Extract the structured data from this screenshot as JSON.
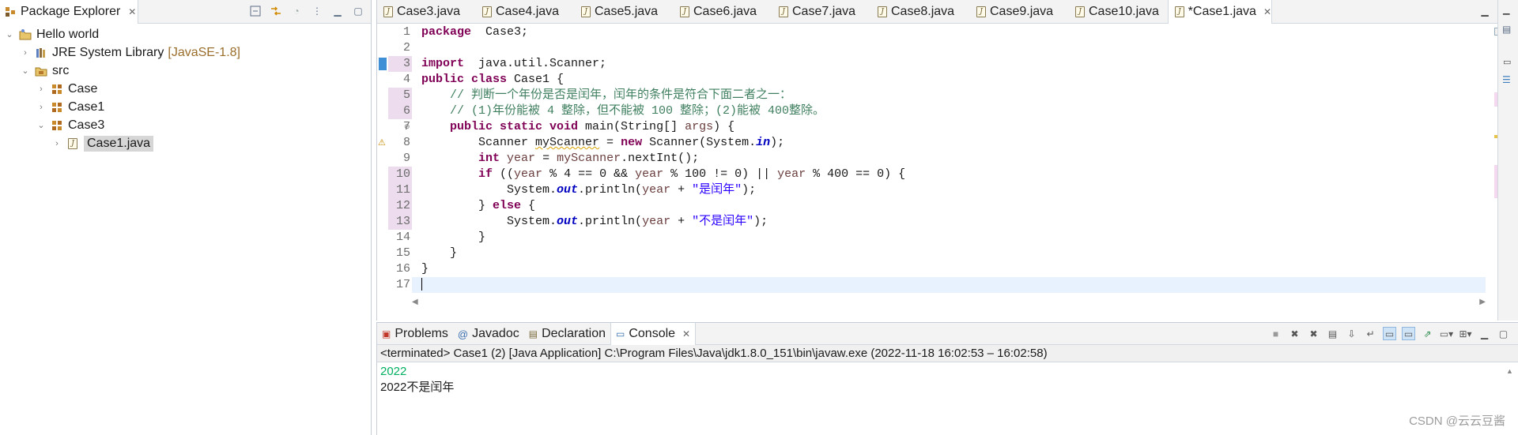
{
  "package_explorer": {
    "title": "Package Explorer",
    "tree": [
      {
        "label": "Hello world",
        "decorator": "",
        "depth": 0,
        "state": "expanded",
        "icon": "project-icon"
      },
      {
        "label": "JRE System Library",
        "decorator": "[JavaSE-1.8]",
        "depth": 1,
        "state": "collapsed",
        "icon": "library-icon"
      },
      {
        "label": "src",
        "decorator": "",
        "depth": 1,
        "state": "expanded",
        "icon": "source-folder-icon"
      },
      {
        "label": "Case",
        "decorator": "",
        "depth": 2,
        "state": "collapsed",
        "icon": "package-icon"
      },
      {
        "label": "Case1",
        "decorator": "",
        "depth": 2,
        "state": "collapsed",
        "icon": "package-icon"
      },
      {
        "label": "Case3",
        "decorator": "",
        "depth": 2,
        "state": "expanded",
        "icon": "package-icon"
      },
      {
        "label": "Case1.java",
        "decorator": "",
        "depth": 3,
        "state": "collapsed",
        "icon": "java-file-icon",
        "selected": true
      }
    ]
  },
  "editor": {
    "tabs": [
      "Case3.java",
      "Case4.java",
      "Case5.java",
      "Case6.java",
      "Case7.java",
      "Case8.java",
      "Case9.java",
      "Case10.java",
      "*Case1.java"
    ],
    "active_tab": 8,
    "line_numbers": [
      "1",
      "2",
      "3",
      "4",
      "5",
      "6",
      "7",
      "8",
      "9",
      "10",
      "11",
      "12",
      "13",
      "14",
      "15",
      "16",
      "17"
    ],
    "code": [
      [
        [
          "kw",
          "package"
        ],
        [
          "",
          "  Case3;"
        ]
      ],
      [],
      [
        [
          "kw",
          "import"
        ],
        [
          "",
          "  java.util.Scanner;"
        ]
      ],
      [
        [
          "kw",
          "public class"
        ],
        [
          "",
          " Case1 {"
        ]
      ],
      [
        [
          "",
          "    "
        ],
        [
          "cm",
          "// 判断一个年份是否是闰年，闰年的条件是符合下面二者之一："
        ]
      ],
      [
        [
          "",
          "    "
        ],
        [
          "cm",
          "// (1)年份能被 4 整除，但不能被 100 整除；(2)能被 400整除。"
        ]
      ],
      [
        [
          "",
          "    "
        ],
        [
          "kw",
          "public static void"
        ],
        [
          "",
          " main(String[] "
        ],
        [
          "vr",
          "args"
        ],
        [
          "",
          ") {"
        ]
      ],
      [
        [
          "",
          "        Scanner "
        ],
        [
          "wrn",
          "myScanner"
        ],
        [
          "",
          " = "
        ],
        [
          "kw",
          "new"
        ],
        [
          "",
          " Scanner(System."
        ],
        [
          "fi",
          "in"
        ],
        [
          "",
          ");"
        ]
      ],
      [
        [
          "",
          "        "
        ],
        [
          "kw",
          "int"
        ],
        [
          "",
          " "
        ],
        [
          "vr",
          "year"
        ],
        [
          "",
          " = "
        ],
        [
          "vr",
          "myScanner"
        ],
        [
          "",
          ".nextInt();"
        ]
      ],
      [
        [
          "",
          "        "
        ],
        [
          "kw",
          "if"
        ],
        [
          "",
          " (("
        ],
        [
          "vr",
          "year"
        ],
        [
          "",
          " % 4 == 0 && "
        ],
        [
          "vr",
          "year"
        ],
        [
          "",
          " % 100 != 0) || "
        ],
        [
          "vr",
          "year"
        ],
        [
          "",
          " % 400 == 0) {"
        ]
      ],
      [
        [
          "",
          "            System."
        ],
        [
          "fi",
          "out"
        ],
        [
          "",
          ".println("
        ],
        [
          "vr",
          "year"
        ],
        [
          "",
          " + "
        ],
        [
          "st",
          "\"是闰年\""
        ],
        [
          "",
          ");"
        ]
      ],
      [
        [
          "",
          "        } "
        ],
        [
          "kw",
          "else"
        ],
        [
          "",
          " {"
        ]
      ],
      [
        [
          "",
          "            System."
        ],
        [
          "fi",
          "out"
        ],
        [
          "",
          ".println("
        ],
        [
          "vr",
          "year"
        ],
        [
          "",
          " + "
        ],
        [
          "st",
          "\"不是闰年\""
        ],
        [
          "",
          ");"
        ]
      ],
      [
        [
          "",
          "        }"
        ]
      ],
      [
        [
          "",
          "    }"
        ]
      ],
      [
        [
          "",
          "}"
        ]
      ],
      []
    ]
  },
  "console": {
    "tabs": [
      "Problems",
      "Javadoc",
      "Declaration",
      "Console"
    ],
    "active_tab": 3,
    "status": "<terminated> Case1 (2) [Java Application] C:\\Program Files\\Java\\jdk1.8.0_151\\bin\\javaw.exe  (2022-11-18 16:02:53 – 16:02:58)",
    "output": [
      {
        "text": "2022",
        "kind": "input"
      },
      {
        "text": "2022不是闰年",
        "kind": "output"
      }
    ]
  },
  "watermark": "CSDN @云云豆酱",
  "colors": {
    "keyword": "#7f0055",
    "comment": "#3f7f5f",
    "string": "#2a00ff",
    "field": "#0000c0",
    "local_var": "#6a3e3e",
    "console_input": "#00b060",
    "current_line": "#e8f2fe"
  }
}
